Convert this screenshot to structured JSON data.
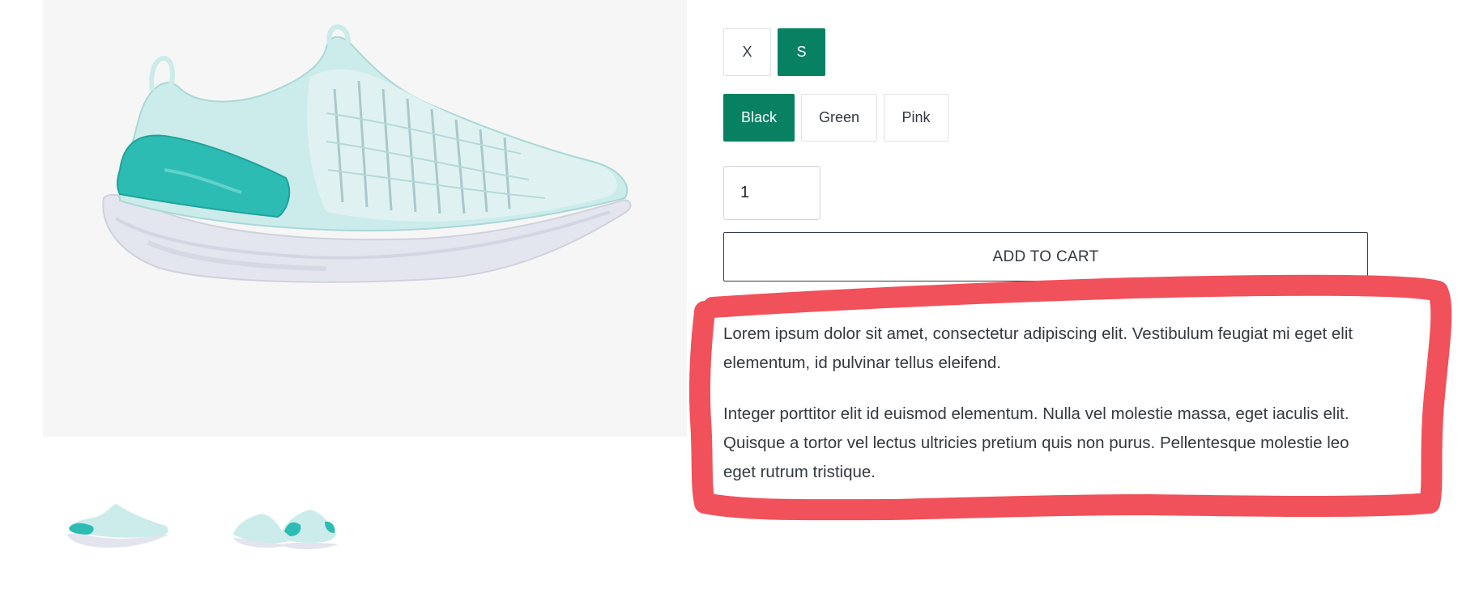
{
  "product": {
    "image_alt": "shoe",
    "thumbnails": [
      {
        "label": "thumbnail 1"
      },
      {
        "label": "thumbnail 2"
      }
    ]
  },
  "options": {
    "sizes": [
      {
        "label": "X",
        "selected": false
      },
      {
        "label": "S",
        "selected": true
      }
    ],
    "colors": [
      {
        "label": "Black",
        "selected": true
      },
      {
        "label": "Green",
        "selected": false
      },
      {
        "label": "Pink",
        "selected": false
      }
    ]
  },
  "quantity": {
    "value": "1"
  },
  "cart": {
    "add_label": "ADD TO CART"
  },
  "description": {
    "paragraphs": [
      "Lorem ipsum dolor sit amet, consectetur adipiscing elit. Vestibulum feugiat mi eget elit elementum, id pulvinar tellus eleifend.",
      "Integer porttitor elit id euismod elementum. Nulla vel molestie massa, eget iaculis elit. Quisque a tortor vel lectus ultricies pretium quis non purus. Pellentesque molestie leo eget rutrum tristique."
    ]
  },
  "colors": {
    "accent": "#078162",
    "image_bg": "#f6f6f6",
    "annotation": "#f0515a",
    "text": "#343a40"
  }
}
